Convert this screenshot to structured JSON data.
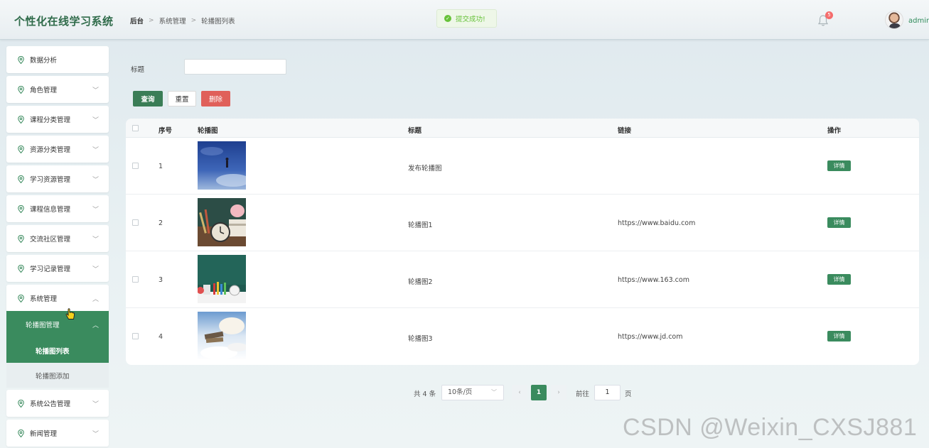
{
  "header": {
    "app_title": "个性化在线学习系统",
    "breadcrumb": [
      "后台",
      "系统管理",
      "轮播图列表"
    ],
    "toast": "提交成功!",
    "notification_count": "5",
    "username": "admin"
  },
  "sidebar": {
    "items": [
      {
        "label": "数据分析",
        "has_children": false
      },
      {
        "label": "角色管理",
        "has_children": true
      },
      {
        "label": "课程分类管理",
        "has_children": true
      },
      {
        "label": "资源分类管理",
        "has_children": true
      },
      {
        "label": "学习资源管理",
        "has_children": true
      },
      {
        "label": "课程信息管理",
        "has_children": true
      },
      {
        "label": "交流社区管理",
        "has_children": true
      },
      {
        "label": "学习记录管理",
        "has_children": true
      },
      {
        "label": "系统管理",
        "has_children": true,
        "expanded": true
      }
    ],
    "submenu": {
      "label": "轮播图管理",
      "items": [
        "轮播图列表",
        "轮播图添加"
      ]
    },
    "items_after": [
      {
        "label": "系统公告管理"
      },
      {
        "label": "新闻管理"
      }
    ]
  },
  "search": {
    "label": "标题",
    "value": ""
  },
  "toolbar": {
    "query": "查询",
    "reset": "重置",
    "delete": "删除"
  },
  "table": {
    "columns": [
      "序号",
      "轮播图",
      "标题",
      "链接",
      "操作"
    ],
    "rows": [
      {
        "index": "1",
        "title": "发布轮播图",
        "link": "",
        "action": "详情"
      },
      {
        "index": "2",
        "title": "轮播图1",
        "link": "https://www.baidu.com",
        "action": "详情"
      },
      {
        "index": "3",
        "title": "轮播图2",
        "link": "https://www.163.com",
        "action": "详情"
      },
      {
        "index": "4",
        "title": "轮播图3",
        "link": "https://www.jd.com",
        "action": "详情"
      }
    ]
  },
  "pagination": {
    "total": "共 4 条",
    "page_size": "10条/页",
    "current_page": "1",
    "goto_label": "前往",
    "goto_value": "1",
    "page_unit": "页"
  },
  "watermark": "CSDN @Weixin_CXSJ881",
  "colors": {
    "primary": "#3a8b5e",
    "danger": "#e0605a",
    "success": "#67c23a"
  }
}
